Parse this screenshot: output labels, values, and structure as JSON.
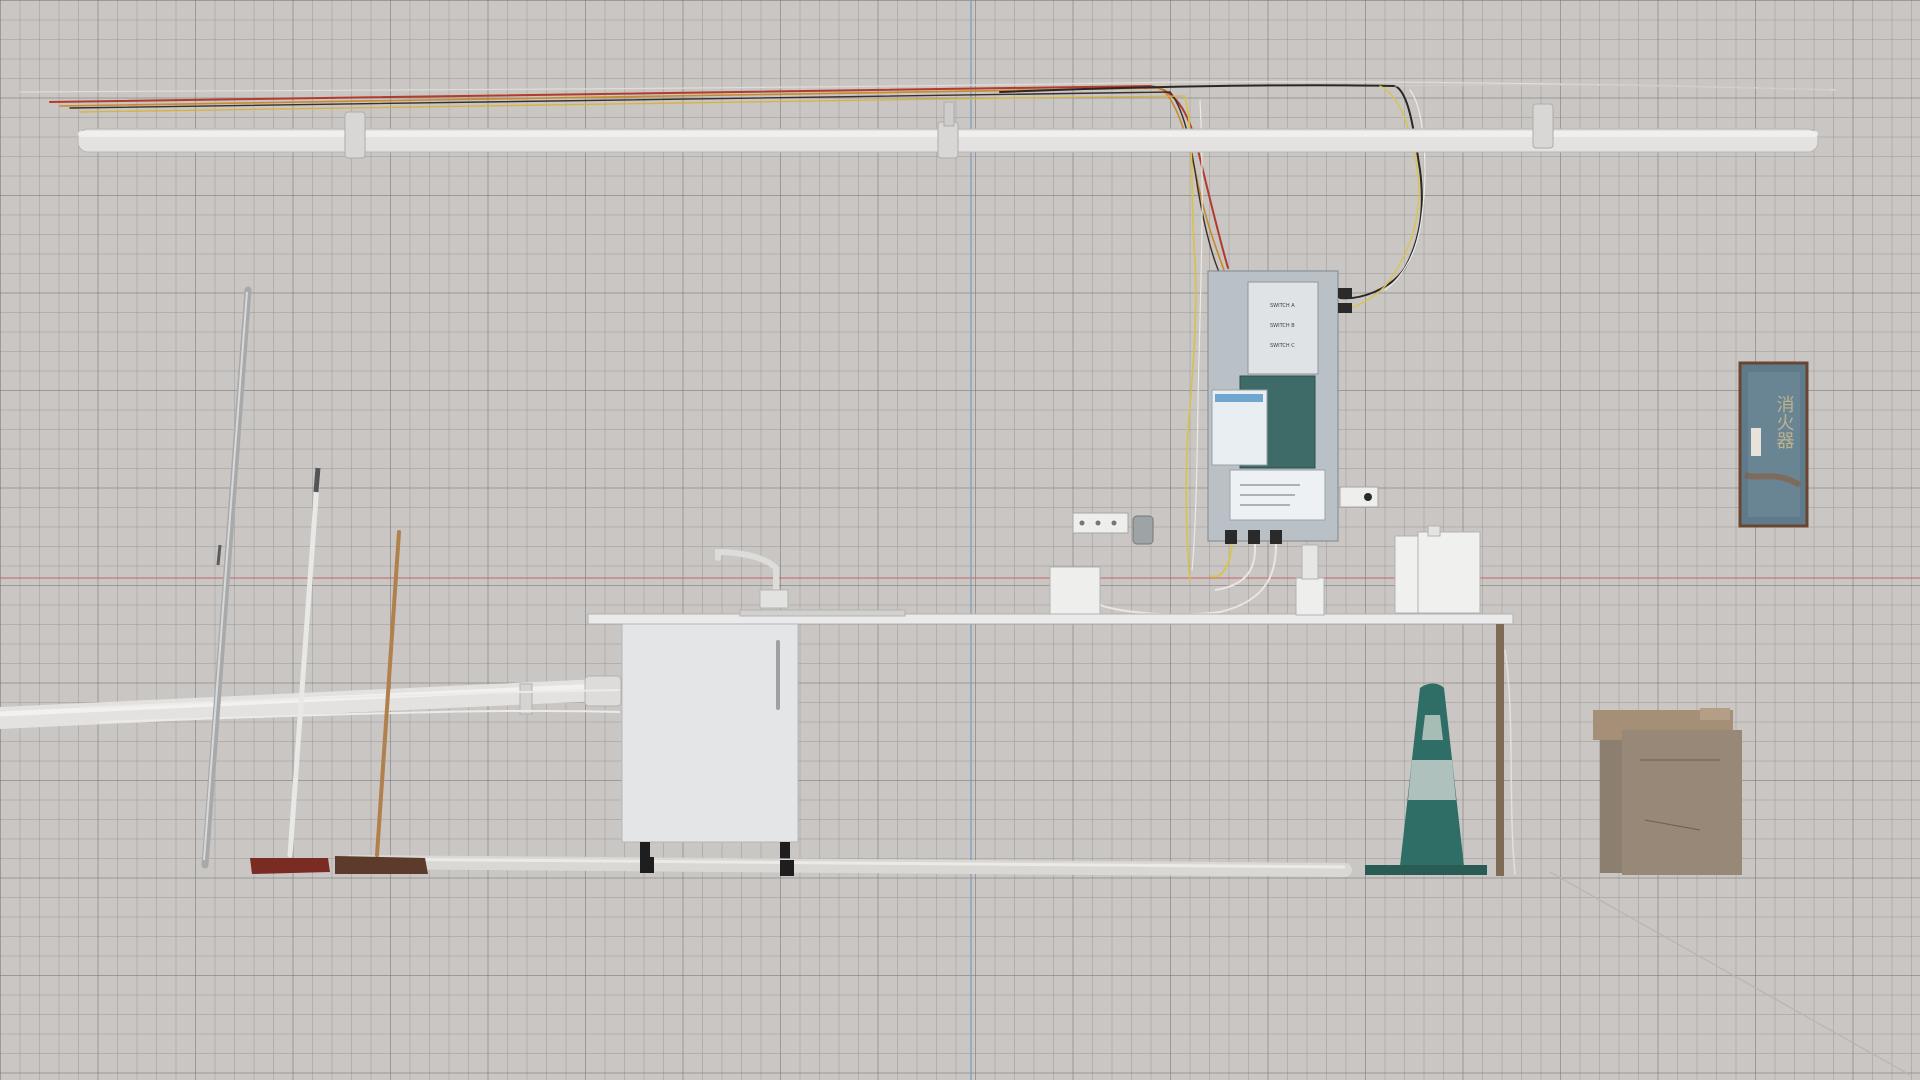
{
  "scene": {
    "title": "",
    "view": "front-orthographic",
    "background_color": "#c9c6c3",
    "grid_color": "#8f8c89",
    "axis_x_color": "#c8646a",
    "axis_y_color": "#7f9cc0"
  },
  "objects": {
    "ceiling_pipe": {
      "name": "ceiling-pipe"
    },
    "wires": {
      "name": "ceiling-wires"
    },
    "fuse_board": {
      "panel_labels": [
        "SWITCH A",
        "SWITCH B",
        "SWITCH C"
      ]
    },
    "fire_extinguisher_sign": {
      "text": "消火器",
      "color": "#5f7a8a"
    },
    "traffic_cone": {
      "color": "#2f6e66"
    },
    "cardboard_boxes": {
      "color": "#8d7f70"
    }
  }
}
